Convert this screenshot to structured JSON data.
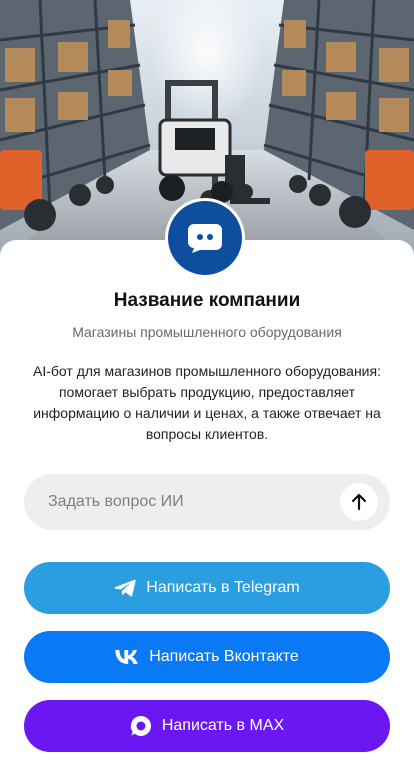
{
  "company": {
    "name": "Название компании",
    "subtitle": "Магазины промышленного оборудования",
    "description": "AI-бот для магазинов промышленного оборудования: помогает выбрать продукцию, предоставляет информацию о наличии и ценах, а также отвечает на вопросы клиентов."
  },
  "ask": {
    "placeholder": "Задать вопрос ИИ",
    "value": ""
  },
  "buttons": {
    "telegram": "Написать в Telegram",
    "vk": "Написать Вконтакте",
    "max": "Написать в MAX"
  },
  "colors": {
    "telegram": "#2a9ee0",
    "vk": "#0a79f6",
    "max": "#6a17f2",
    "avatar": "#0e4e9e"
  },
  "icons": {
    "logo": "chat-bubble-icon",
    "send": "arrow-up-icon",
    "telegram": "telegram-icon",
    "vk": "vk-icon",
    "max": "max-icon"
  }
}
